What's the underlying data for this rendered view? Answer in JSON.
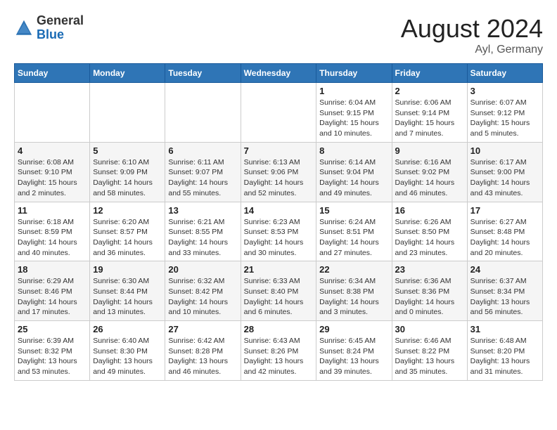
{
  "header": {
    "logo_general": "General",
    "logo_blue": "Blue",
    "month_year": "August 2024",
    "location": "Ayl, Germany"
  },
  "days_of_week": [
    "Sunday",
    "Monday",
    "Tuesday",
    "Wednesday",
    "Thursday",
    "Friday",
    "Saturday"
  ],
  "weeks": [
    {
      "row_class": "row-odd",
      "days": [
        {
          "day": "",
          "info": ""
        },
        {
          "day": "",
          "info": ""
        },
        {
          "day": "",
          "info": ""
        },
        {
          "day": "",
          "info": ""
        },
        {
          "day": "1",
          "info": "Sunrise: 6:04 AM\nSunset: 9:15 PM\nDaylight: 15 hours and 10 minutes."
        },
        {
          "day": "2",
          "info": "Sunrise: 6:06 AM\nSunset: 9:14 PM\nDaylight: 15 hours and 7 minutes."
        },
        {
          "day": "3",
          "info": "Sunrise: 6:07 AM\nSunset: 9:12 PM\nDaylight: 15 hours and 5 minutes."
        }
      ]
    },
    {
      "row_class": "row-even",
      "days": [
        {
          "day": "4",
          "info": "Sunrise: 6:08 AM\nSunset: 9:10 PM\nDaylight: 15 hours and 2 minutes."
        },
        {
          "day": "5",
          "info": "Sunrise: 6:10 AM\nSunset: 9:09 PM\nDaylight: 14 hours and 58 minutes."
        },
        {
          "day": "6",
          "info": "Sunrise: 6:11 AM\nSunset: 9:07 PM\nDaylight: 14 hours and 55 minutes."
        },
        {
          "day": "7",
          "info": "Sunrise: 6:13 AM\nSunset: 9:06 PM\nDaylight: 14 hours and 52 minutes."
        },
        {
          "day": "8",
          "info": "Sunrise: 6:14 AM\nSunset: 9:04 PM\nDaylight: 14 hours and 49 minutes."
        },
        {
          "day": "9",
          "info": "Sunrise: 6:16 AM\nSunset: 9:02 PM\nDaylight: 14 hours and 46 minutes."
        },
        {
          "day": "10",
          "info": "Sunrise: 6:17 AM\nSunset: 9:00 PM\nDaylight: 14 hours and 43 minutes."
        }
      ]
    },
    {
      "row_class": "row-odd",
      "days": [
        {
          "day": "11",
          "info": "Sunrise: 6:18 AM\nSunset: 8:59 PM\nDaylight: 14 hours and 40 minutes."
        },
        {
          "day": "12",
          "info": "Sunrise: 6:20 AM\nSunset: 8:57 PM\nDaylight: 14 hours and 36 minutes."
        },
        {
          "day": "13",
          "info": "Sunrise: 6:21 AM\nSunset: 8:55 PM\nDaylight: 14 hours and 33 minutes."
        },
        {
          "day": "14",
          "info": "Sunrise: 6:23 AM\nSunset: 8:53 PM\nDaylight: 14 hours and 30 minutes."
        },
        {
          "day": "15",
          "info": "Sunrise: 6:24 AM\nSunset: 8:51 PM\nDaylight: 14 hours and 27 minutes."
        },
        {
          "day": "16",
          "info": "Sunrise: 6:26 AM\nSunset: 8:50 PM\nDaylight: 14 hours and 23 minutes."
        },
        {
          "day": "17",
          "info": "Sunrise: 6:27 AM\nSunset: 8:48 PM\nDaylight: 14 hours and 20 minutes."
        }
      ]
    },
    {
      "row_class": "row-even",
      "days": [
        {
          "day": "18",
          "info": "Sunrise: 6:29 AM\nSunset: 8:46 PM\nDaylight: 14 hours and 17 minutes."
        },
        {
          "day": "19",
          "info": "Sunrise: 6:30 AM\nSunset: 8:44 PM\nDaylight: 14 hours and 13 minutes."
        },
        {
          "day": "20",
          "info": "Sunrise: 6:32 AM\nSunset: 8:42 PM\nDaylight: 14 hours and 10 minutes."
        },
        {
          "day": "21",
          "info": "Sunrise: 6:33 AM\nSunset: 8:40 PM\nDaylight: 14 hours and 6 minutes."
        },
        {
          "day": "22",
          "info": "Sunrise: 6:34 AM\nSunset: 8:38 PM\nDaylight: 14 hours and 3 minutes."
        },
        {
          "day": "23",
          "info": "Sunrise: 6:36 AM\nSunset: 8:36 PM\nDaylight: 14 hours and 0 minutes."
        },
        {
          "day": "24",
          "info": "Sunrise: 6:37 AM\nSunset: 8:34 PM\nDaylight: 13 hours and 56 minutes."
        }
      ]
    },
    {
      "row_class": "row-odd",
      "days": [
        {
          "day": "25",
          "info": "Sunrise: 6:39 AM\nSunset: 8:32 PM\nDaylight: 13 hours and 53 minutes."
        },
        {
          "day": "26",
          "info": "Sunrise: 6:40 AM\nSunset: 8:30 PM\nDaylight: 13 hours and 49 minutes."
        },
        {
          "day": "27",
          "info": "Sunrise: 6:42 AM\nSunset: 8:28 PM\nDaylight: 13 hours and 46 minutes."
        },
        {
          "day": "28",
          "info": "Sunrise: 6:43 AM\nSunset: 8:26 PM\nDaylight: 13 hours and 42 minutes."
        },
        {
          "day": "29",
          "info": "Sunrise: 6:45 AM\nSunset: 8:24 PM\nDaylight: 13 hours and 39 minutes."
        },
        {
          "day": "30",
          "info": "Sunrise: 6:46 AM\nSunset: 8:22 PM\nDaylight: 13 hours and 35 minutes."
        },
        {
          "day": "31",
          "info": "Sunrise: 6:48 AM\nSunset: 8:20 PM\nDaylight: 13 hours and 31 minutes."
        }
      ]
    }
  ]
}
